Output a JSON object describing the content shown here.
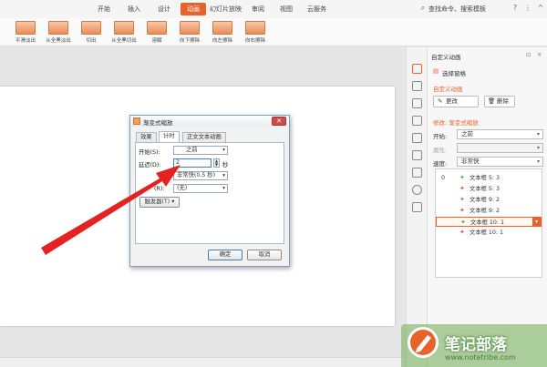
{
  "menubar": {
    "items": [
      "开始",
      "插入",
      "设计",
      "动画",
      "幻灯片放映",
      "审阅",
      "视图",
      "云服务"
    ],
    "active_index": 3,
    "search": "查找命令、搜索模板",
    "accent": "#e8622b"
  },
  "ribbon": {
    "buttons": [
      "平滑淡出",
      "从全黑淡出",
      "切出",
      "从全黑切出",
      "溶解",
      "向下擦除",
      "向左擦除",
      "向右擦除"
    ]
  },
  "task_pane": {
    "title": "自定义动画",
    "select_pane": "选择窗格",
    "section": "自定义动画",
    "change_btn": "更改",
    "delete_btn": "删除",
    "modify": "修改: 渐变式缩放",
    "start_label": "开始:",
    "start_value": "之前",
    "property_label": "属性:",
    "speed_label": "速度:",
    "speed_value": "非常快",
    "list": [
      {
        "num": "0",
        "icon": "green",
        "label": "文本框 5: 3"
      },
      {
        "num": "",
        "icon": "red",
        "label": "文本框 5: 3"
      },
      {
        "num": "",
        "icon": "green",
        "label": "文本框 9: 2"
      },
      {
        "num": "",
        "icon": "red",
        "label": "文本框 9: 2"
      },
      {
        "num": "",
        "icon": "green",
        "label": "文本框 10: 1",
        "selected": true
      },
      {
        "num": "",
        "icon": "red",
        "label": "文本框 10: 1"
      }
    ]
  },
  "dialog": {
    "title": "渐变式缩放",
    "tabs": [
      "效果",
      "计时",
      "正文文本动画"
    ],
    "active_tab": 1,
    "start_label": "开始(S):",
    "start_value": "之前",
    "delay_label": "延迟(D):",
    "delay_value": "2",
    "delay_unit": "秒",
    "speed_value": "非常快(0.5 秒)",
    "repeat_label": "(R):",
    "repeat_value": "(无)",
    "trigger_btn": "触发器(T)",
    "ok": "确定",
    "cancel": "取消"
  },
  "watermark": {
    "title": "笔记部落",
    "url": "www.notetribe.com"
  }
}
